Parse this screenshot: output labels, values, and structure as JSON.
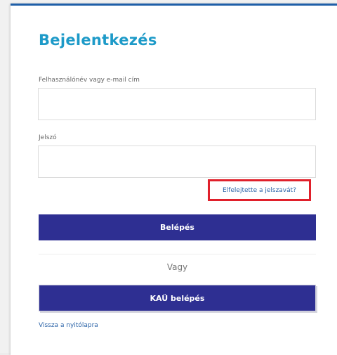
{
  "login": {
    "title": "Bejelentkezés",
    "username_label": "Felhasználónév vagy e-mail cím",
    "username_value": "",
    "password_label": "Jelszó",
    "password_value": "",
    "forgot_password": "Elfelejtette a jelszavát?",
    "login_button": "Belépés",
    "or_text": "Vagy",
    "kau_button": "KAÜ belépés",
    "back_link": "Vissza a nyitólapra"
  },
  "colors": {
    "title": "#1d9ac8",
    "button": "#2e2f92",
    "link": "#2c64a8",
    "highlight": "#e0202b",
    "top_border": "#1f5fa8"
  }
}
